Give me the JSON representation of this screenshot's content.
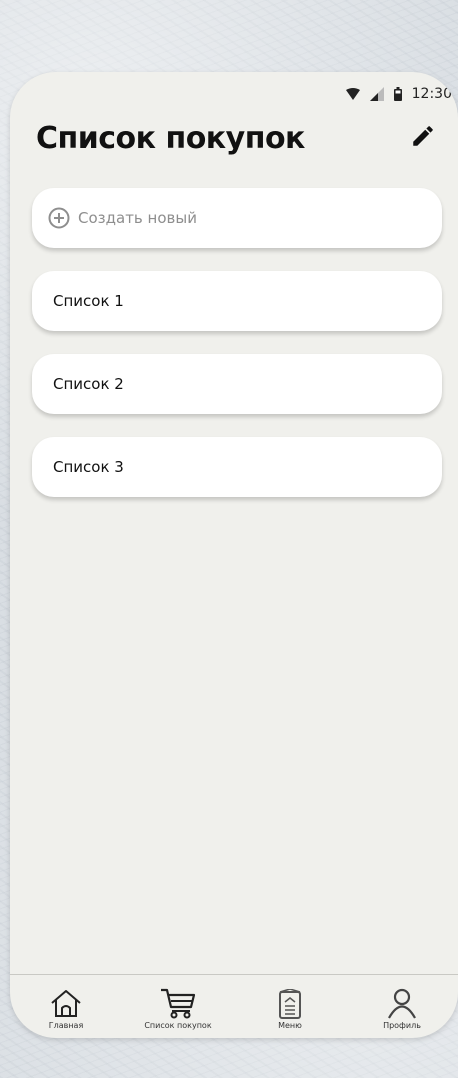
{
  "status_bar": {
    "time": "12:30",
    "icons": [
      "wifi-icon",
      "signal-icon",
      "battery-icon"
    ]
  },
  "header": {
    "title": "Список покупок",
    "edit_icon": "pencil-icon"
  },
  "create_item": {
    "label": "Создать новый",
    "icon": "plus-circle-icon"
  },
  "lists": [
    {
      "label": "Список 1"
    },
    {
      "label": "Список 2"
    },
    {
      "label": "Список 3"
    }
  ],
  "bottom_nav": {
    "items": [
      {
        "label": "Главная",
        "icon": "home-icon"
      },
      {
        "label": "Список покупок",
        "icon": "cart-icon",
        "active": true
      },
      {
        "label": "Меню",
        "icon": "menu-book-icon"
      },
      {
        "label": "Профиль",
        "icon": "profile-icon"
      }
    ]
  },
  "colors": {
    "background": "#f0f0ec",
    "card": "#ffffff",
    "placeholder": "#8e8e8e",
    "text": "#111111"
  }
}
